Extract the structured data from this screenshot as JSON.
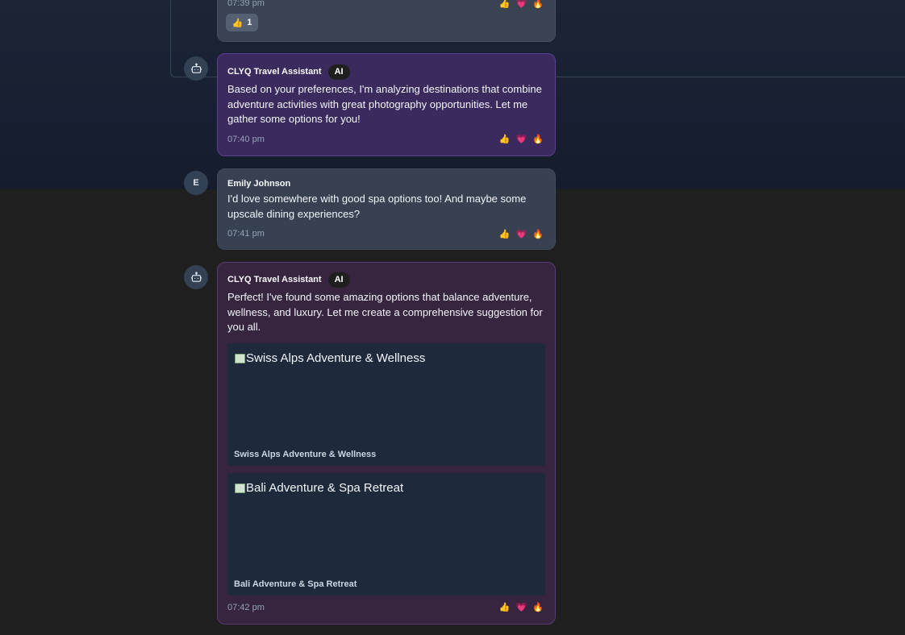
{
  "top_message": {
    "time": "07:39 pm",
    "reaction": {
      "emoji": "👍",
      "count": "1"
    },
    "reactions": [
      "👍",
      "💗",
      "🔥"
    ]
  },
  "msg1": {
    "sender": "CLYQ Travel Assistant",
    "badge": "AI",
    "text": "Based on your preferences, I'm analyzing destinations that combine adventure activities with great photography opportunities. Let me gather some options for you!",
    "time": "07:40 pm",
    "reactions": [
      "👍",
      "💗",
      "🔥"
    ]
  },
  "msg2": {
    "avatar": "E",
    "sender": "Emily Johnson",
    "text": "I'd love somewhere with good spa options too! And maybe some upscale dining experiences?",
    "time": "07:41 pm",
    "reactions": [
      "👍",
      "💗",
      "🔥"
    ]
  },
  "msg3": {
    "sender": "CLYQ Travel Assistant",
    "badge": "AI",
    "text": "Perfect! I've found some amazing options that balance adventure, wellness, and luxury. Let me create a comprehensive suggestion for you all.",
    "cards": [
      {
        "alt": "Swiss Alps Adventure & Wellness",
        "caption": "Swiss Alps Adventure & Wellness"
      },
      {
        "alt": "Bali Adventure & Spa Retreat",
        "caption": "Bali Adventure & Spa Retreat"
      }
    ],
    "time": "07:42 pm",
    "reactions": [
      "👍",
      "💗",
      "🔥"
    ]
  },
  "colors": {
    "ai_bubble": "#3b2a5e",
    "user_bubble": "#374151",
    "page_bg": "#1f1f1f"
  }
}
